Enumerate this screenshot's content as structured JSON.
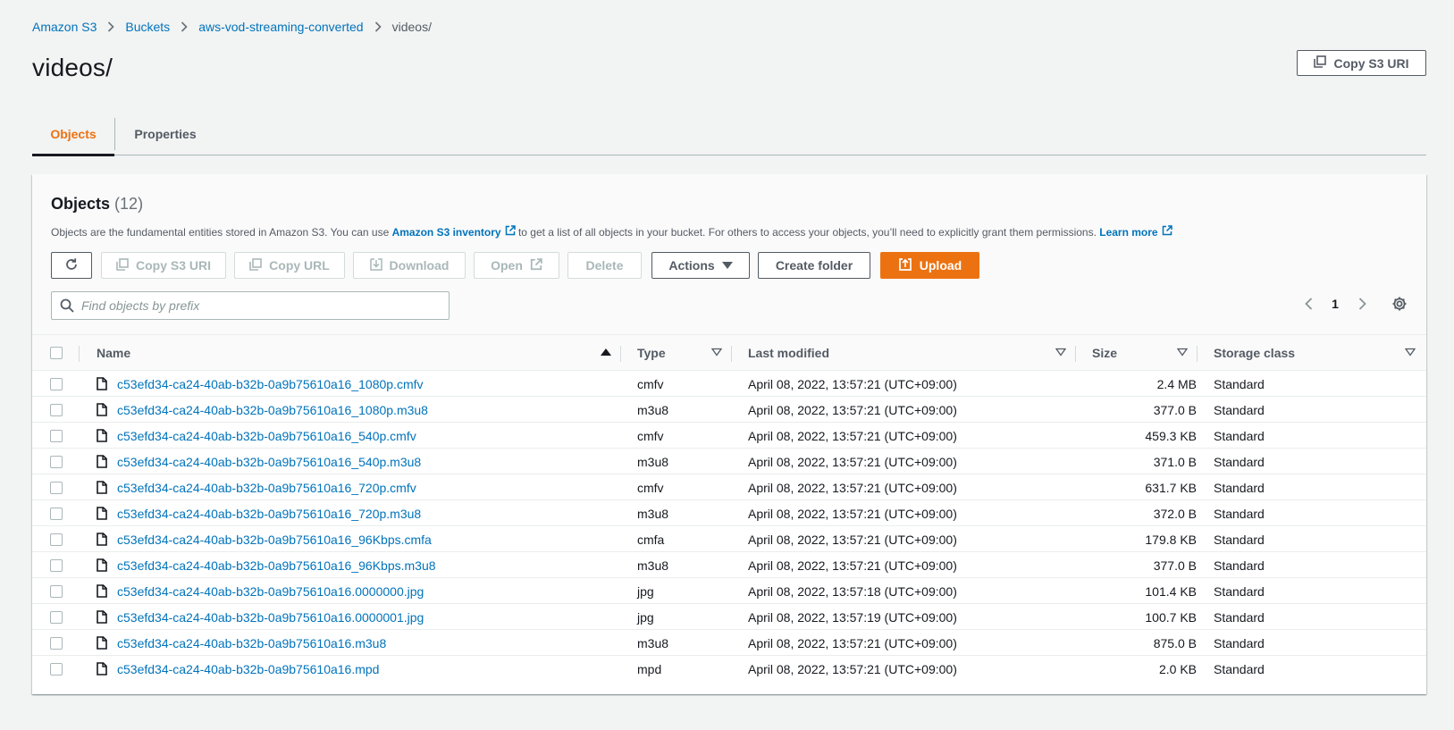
{
  "breadcrumb": [
    "Amazon S3",
    "Buckets",
    "aws-vod-streaming-converted",
    "videos/"
  ],
  "page_title": "videos/",
  "header_copy_uri": "Copy S3 URI",
  "tabs": [
    {
      "label": "Objects",
      "active": true
    },
    {
      "label": "Properties",
      "active": false
    }
  ],
  "panel": {
    "title": "Objects",
    "count": "(12)",
    "desc_part1": "Objects are the fundamental entities stored in Amazon S3. You can use ",
    "desc_link1": "Amazon S3 inventory",
    "desc_part2": " to get a list of all objects in your bucket. For others to access your objects, you’ll need to explicitly grant them permissions. ",
    "desc_link2": "Learn more"
  },
  "toolbar": {
    "copy_s3_uri": "Copy S3 URI",
    "copy_url": "Copy URL",
    "download": "Download",
    "open": "Open",
    "delete": "Delete",
    "actions": "Actions",
    "create_folder": "Create folder",
    "upload": "Upload"
  },
  "search": {
    "placeholder": "Find objects by prefix"
  },
  "pagination": {
    "page": "1"
  },
  "table": {
    "columns": [
      "Name",
      "Type",
      "Last modified",
      "Size",
      "Storage class"
    ],
    "rows": [
      {
        "name": "c53efd34-ca24-40ab-b32b-0a9b75610a16_1080p.cmfv",
        "type": "cmfv",
        "modified": "April 08, 2022, 13:57:21 (UTC+09:00)",
        "size": "2.4 MB",
        "storage": "Standard"
      },
      {
        "name": "c53efd34-ca24-40ab-b32b-0a9b75610a16_1080p.m3u8",
        "type": "m3u8",
        "modified": "April 08, 2022, 13:57:21 (UTC+09:00)",
        "size": "377.0 B",
        "storage": "Standard"
      },
      {
        "name": "c53efd34-ca24-40ab-b32b-0a9b75610a16_540p.cmfv",
        "type": "cmfv",
        "modified": "April 08, 2022, 13:57:21 (UTC+09:00)",
        "size": "459.3 KB",
        "storage": "Standard"
      },
      {
        "name": "c53efd34-ca24-40ab-b32b-0a9b75610a16_540p.m3u8",
        "type": "m3u8",
        "modified": "April 08, 2022, 13:57:21 (UTC+09:00)",
        "size": "371.0 B",
        "storage": "Standard"
      },
      {
        "name": "c53efd34-ca24-40ab-b32b-0a9b75610a16_720p.cmfv",
        "type": "cmfv",
        "modified": "April 08, 2022, 13:57:21 (UTC+09:00)",
        "size": "631.7 KB",
        "storage": "Standard"
      },
      {
        "name": "c53efd34-ca24-40ab-b32b-0a9b75610a16_720p.m3u8",
        "type": "m3u8",
        "modified": "April 08, 2022, 13:57:21 (UTC+09:00)",
        "size": "372.0 B",
        "storage": "Standard"
      },
      {
        "name": "c53efd34-ca24-40ab-b32b-0a9b75610a16_96Kbps.cmfa",
        "type": "cmfa",
        "modified": "April 08, 2022, 13:57:21 (UTC+09:00)",
        "size": "179.8 KB",
        "storage": "Standard"
      },
      {
        "name": "c53efd34-ca24-40ab-b32b-0a9b75610a16_96Kbps.m3u8",
        "type": "m3u8",
        "modified": "April 08, 2022, 13:57:21 (UTC+09:00)",
        "size": "377.0 B",
        "storage": "Standard"
      },
      {
        "name": "c53efd34-ca24-40ab-b32b-0a9b75610a16.0000000.jpg",
        "type": "jpg",
        "modified": "April 08, 2022, 13:57:18 (UTC+09:00)",
        "size": "101.4 KB",
        "storage": "Standard"
      },
      {
        "name": "c53efd34-ca24-40ab-b32b-0a9b75610a16.0000001.jpg",
        "type": "jpg",
        "modified": "April 08, 2022, 13:57:19 (UTC+09:00)",
        "size": "100.7 KB",
        "storage": "Standard"
      },
      {
        "name": "c53efd34-ca24-40ab-b32b-0a9b75610a16.m3u8",
        "type": "m3u8",
        "modified": "April 08, 2022, 13:57:21 (UTC+09:00)",
        "size": "875.0 B",
        "storage": "Standard"
      },
      {
        "name": "c53efd34-ca24-40ab-b32b-0a9b75610a16.mpd",
        "type": "mpd",
        "modified": "April 08, 2022, 13:57:21 (UTC+09:00)",
        "size": "2.0 KB",
        "storage": "Standard"
      }
    ]
  },
  "colors": {
    "accent": "#ec7211",
    "link": "#0073bb",
    "text": "#16191f",
    "muted": "#545b64",
    "background": "#f2f3f3"
  },
  "icons": [
    "chevron-right-icon",
    "copy-icon",
    "refresh-icon",
    "download-icon",
    "external-link-icon",
    "caret-down-icon",
    "upload-icon",
    "search-icon",
    "chevron-left-icon",
    "settings-icon",
    "sort-ascending-icon",
    "sort-icon",
    "file-icon"
  ]
}
